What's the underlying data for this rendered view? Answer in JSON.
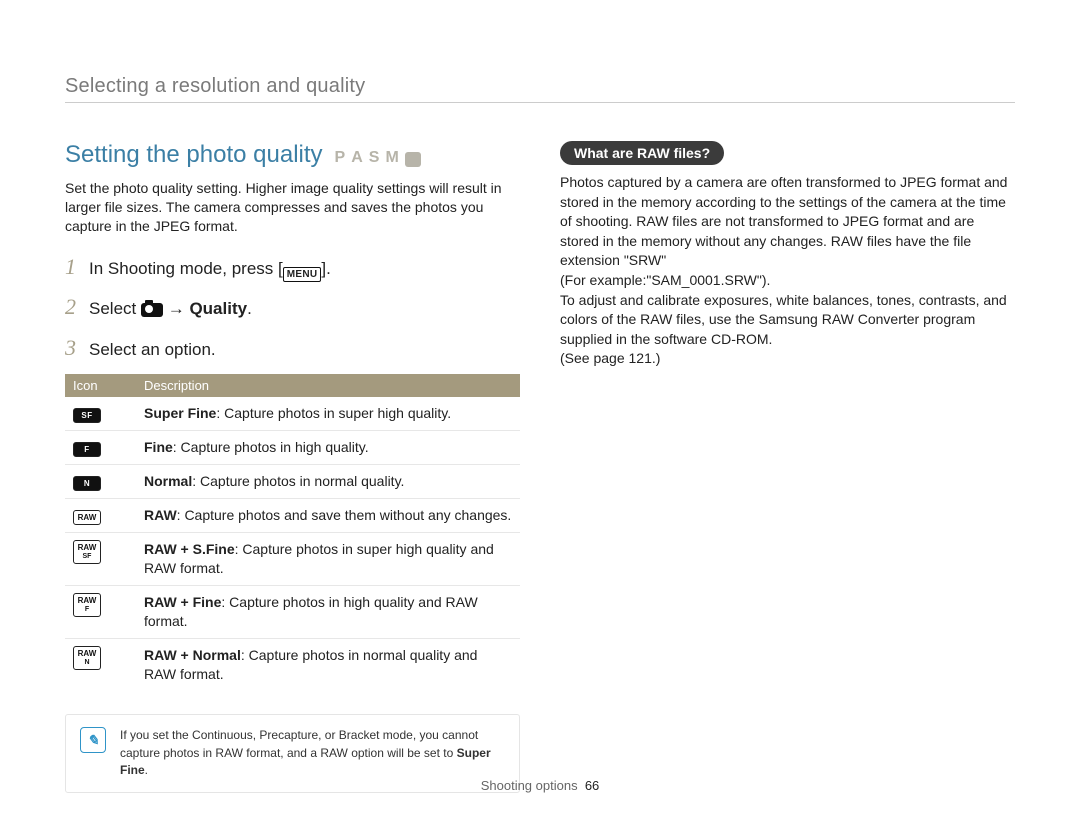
{
  "breadcrumb": "Selecting a resolution and quality",
  "section_title": "Setting the photo quality",
  "mode_letters": [
    "P",
    "A",
    "S",
    "M"
  ],
  "intro": "Set the photo quality setting. Higher image quality settings will result in larger file sizes. The camera compresses and saves the photos you capture in the JPEG format.",
  "steps": {
    "one_a": "In Shooting mode, press [",
    "one_menu": "MENU",
    "one_b": "].",
    "two_a": "Select ",
    "two_arrow": " → ",
    "two_bold": "Quality",
    "two_b": ".",
    "three": "Select an option."
  },
  "table": {
    "head_icon": "Icon",
    "head_desc": "Description",
    "rows": [
      {
        "icon": "SF",
        "style": "grid",
        "bold": "Super Fine",
        "text": ": Capture photos in super high quality."
      },
      {
        "icon": "F",
        "style": "grid",
        "bold": "Fine",
        "text": ": Capture photos in high quality."
      },
      {
        "icon": "N",
        "style": "grid",
        "bold": "Normal",
        "text": ": Capture photos in normal quality."
      },
      {
        "icon": "RAW",
        "style": "line",
        "bold": "RAW",
        "text": ": Capture photos and save them without any changes."
      },
      {
        "icon": "RAW\nSF",
        "style": "line",
        "bold": "RAW + S.Fine",
        "text": ": Capture photos in super high quality and RAW format."
      },
      {
        "icon": "RAW\nF",
        "style": "line",
        "bold": "RAW + Fine",
        "text": ": Capture photos in high quality and RAW format."
      },
      {
        "icon": "RAW\nN",
        "style": "line",
        "bold": "RAW + Normal",
        "text": ": Capture photos in normal quality and RAW format."
      }
    ]
  },
  "note": {
    "icon_glyph": "✎",
    "text_a": "If you set the Continuous, Precapture, or Bracket mode, you cannot capture photos in RAW format, and a RAW option will be set to ",
    "text_bold": "Super Fine",
    "text_b": "."
  },
  "pill": "What are RAW files?",
  "raw_body": "Photos captured by a camera are often transformed to JPEG format and stored in the memory according to the settings of the camera at the time of shooting. RAW files are not transformed to JPEG format and are stored in the memory without any changes. RAW files have the file extension \"SRW\"\n(For example:\"SAM_0001.SRW\").\nTo adjust and calibrate exposures, white balances, tones, contrasts, and colors of the RAW files, use the Samsung RAW Converter program supplied in the software CD-ROM.\n(See page 121.)",
  "footer_section": "Shooting options",
  "footer_page": "66"
}
